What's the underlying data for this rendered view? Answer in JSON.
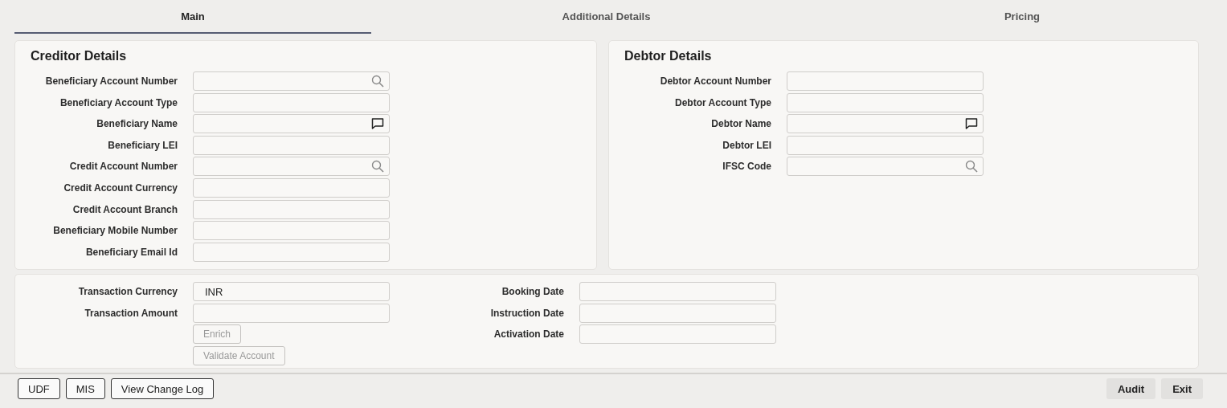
{
  "tabs": [
    {
      "label": "Main",
      "selected": true
    },
    {
      "label": "Additional Details",
      "selected": false
    },
    {
      "label": "Pricing",
      "selected": false
    }
  ],
  "creditor": {
    "title": "Creditor Details",
    "fields": [
      {
        "label": "Beneficiary Account Number",
        "kind": "search"
      },
      {
        "label": "Beneficiary Account Type",
        "kind": "plain"
      },
      {
        "label": "Beneficiary Name",
        "kind": "message"
      },
      {
        "label": "Beneficiary LEI",
        "kind": "plain"
      },
      {
        "label": "Credit Account Number",
        "kind": "search"
      },
      {
        "label": "Credit Account Currency",
        "kind": "plain"
      },
      {
        "label": "Credit Account Branch",
        "kind": "plain"
      },
      {
        "label": "Beneficiary Mobile Number",
        "kind": "plain"
      },
      {
        "label": "Beneficiary Email Id",
        "kind": "plain"
      }
    ]
  },
  "debtor": {
    "title": "Debtor Details",
    "fields": [
      {
        "label": "Debtor Account Number",
        "kind": "plain"
      },
      {
        "label": "Debtor Account Type",
        "kind": "plain"
      },
      {
        "label": "Debtor Name",
        "kind": "message"
      },
      {
        "label": "Debtor LEI",
        "kind": "plain"
      },
      {
        "label": "IFSC Code",
        "kind": "search"
      }
    ]
  },
  "transaction": {
    "left_fields": [
      {
        "label": "Transaction Currency",
        "value": "INR"
      },
      {
        "label": "Transaction Amount"
      }
    ],
    "buttons": [
      {
        "label": "Enrich",
        "disabled": true
      },
      {
        "label": "Validate Account",
        "disabled": true
      }
    ],
    "right_fields": [
      {
        "label": "Booking Date"
      },
      {
        "label": "Instruction Date"
      },
      {
        "label": "Activation Date"
      }
    ]
  },
  "footer": {
    "left_buttons": [
      "UDF",
      "MIS",
      "View Change Log"
    ],
    "right_buttons": [
      "Audit",
      "Exit"
    ]
  }
}
